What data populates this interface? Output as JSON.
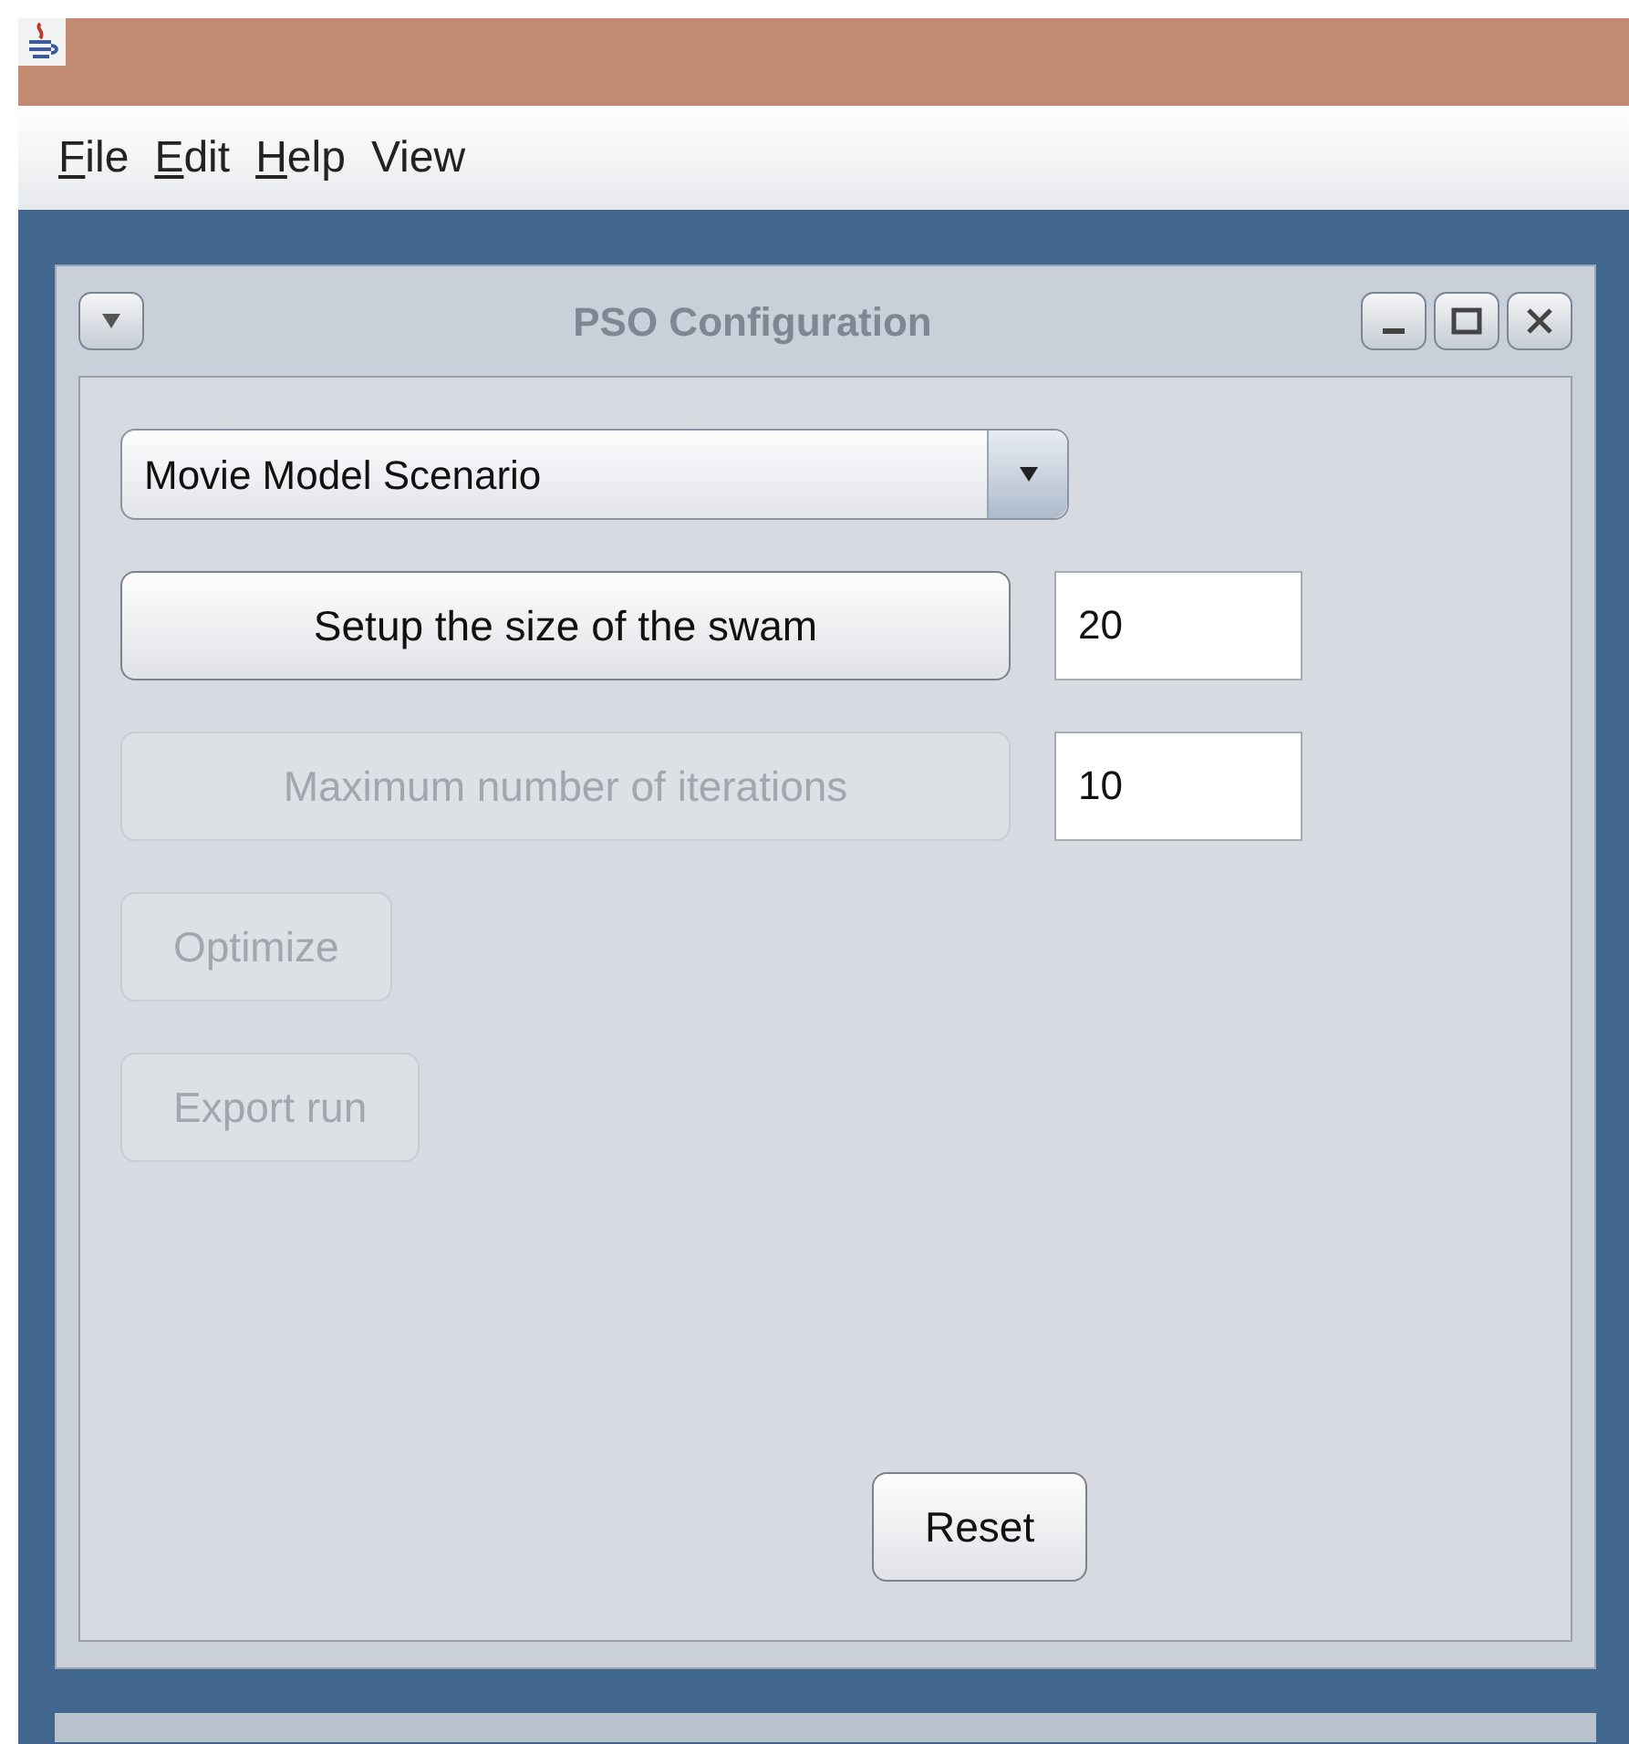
{
  "menu": [
    {
      "label": "File",
      "mnemonic": true
    },
    {
      "label": "Edit",
      "mnemonic": true
    },
    {
      "label": "Help",
      "mnemonic": true
    },
    {
      "label": "View",
      "mnemonic": false
    }
  ],
  "frame": {
    "title": "PSO Configuration"
  },
  "scenario": {
    "value": "Movie Model Scenario"
  },
  "rows": [
    {
      "button": {
        "label": "Setup the size of the swam",
        "disabled": false
      },
      "field": {
        "value": "20"
      }
    },
    {
      "button": {
        "label": "Maximum number of iterations",
        "disabled": true
      },
      "field": {
        "value": "10"
      }
    },
    {
      "button": {
        "label": "Optimize",
        "disabled": true
      }
    },
    {
      "button": {
        "label": "Export run",
        "disabled": true
      }
    }
  ],
  "reset": {
    "label": "Reset",
    "disabled": false
  }
}
